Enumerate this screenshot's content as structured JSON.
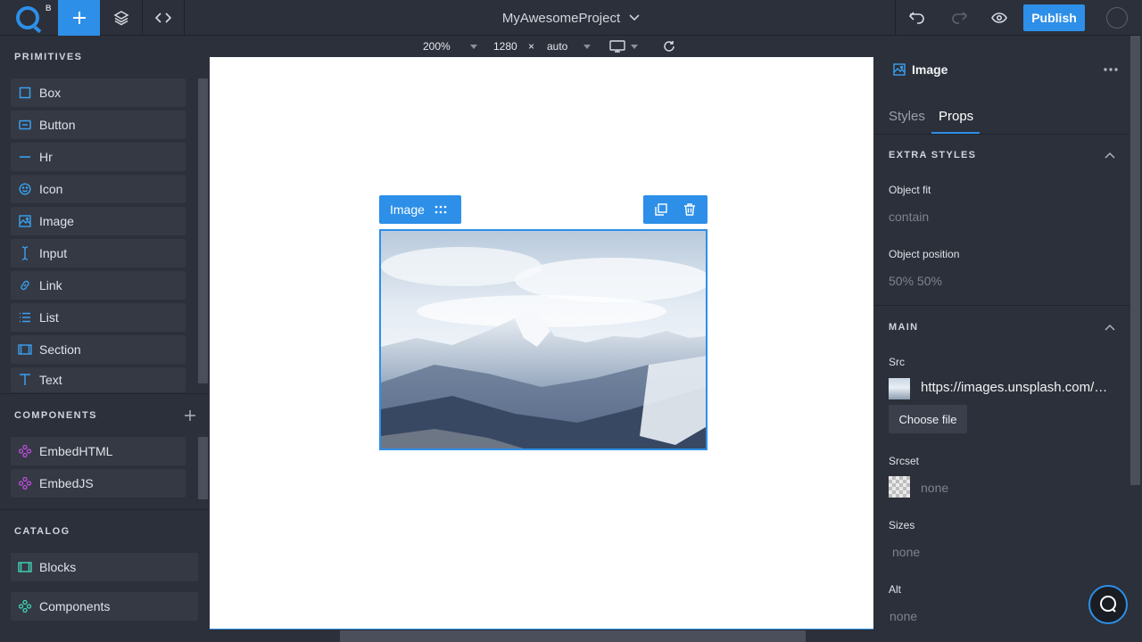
{
  "app": {
    "logo_sup": "B",
    "project_title": "MyAwesomeProject",
    "publish_label": "Publish",
    "accent_color": "#2d8fe8"
  },
  "canvas_toolbar": {
    "zoom": "200%",
    "width": "1280",
    "times": "×",
    "height": "auto",
    "device_icon": "monitor-icon",
    "refresh_icon": "refresh-icon"
  },
  "sidebar": {
    "primitives_title": "PRIMITIVES",
    "primitives": [
      {
        "label": "Box",
        "icon": "box-icon"
      },
      {
        "label": "Button",
        "icon": "button-icon"
      },
      {
        "label": "Hr",
        "icon": "hr-icon"
      },
      {
        "label": "Icon",
        "icon": "smiley-icon"
      },
      {
        "label": "Image",
        "icon": "image-icon"
      },
      {
        "label": "Input",
        "icon": "text-cursor-icon"
      },
      {
        "label": "Link",
        "icon": "link-icon"
      },
      {
        "label": "List",
        "icon": "list-icon"
      },
      {
        "label": "Section",
        "icon": "section-icon"
      },
      {
        "label": "Text",
        "icon": "text-icon"
      }
    ],
    "components_title": "COMPONENTS",
    "components": [
      {
        "label": "EmbedHTML",
        "icon": "component-icon"
      },
      {
        "label": "EmbedJS",
        "icon": "component-icon"
      }
    ],
    "catalog_title": "CATALOG",
    "catalog": [
      {
        "label": "Blocks",
        "icon": "blocks-icon"
      },
      {
        "label": "Components",
        "icon": "component-icon"
      }
    ]
  },
  "selection": {
    "label": "Image",
    "actions": [
      "duplicate-icon",
      "trash-icon"
    ]
  },
  "panel": {
    "title": "Image",
    "tabs": [
      {
        "label": "Styles",
        "active": false
      },
      {
        "label": "Props",
        "active": true
      }
    ],
    "extra_styles_title": "EXTRA STYLES",
    "object_fit_label": "Object fit",
    "object_fit_value": "contain",
    "object_position_label": "Object position",
    "object_position_value": "50% 50%",
    "main_title": "MAIN",
    "src_label": "Src",
    "src_value": "https://images.unsplash.com/…",
    "choose_file_label": "Choose file",
    "srcset_label": "Srcset",
    "srcset_value": "none",
    "sizes_label": "Sizes",
    "sizes_value": "none",
    "alt_label": "Alt",
    "alt_value": "none"
  }
}
